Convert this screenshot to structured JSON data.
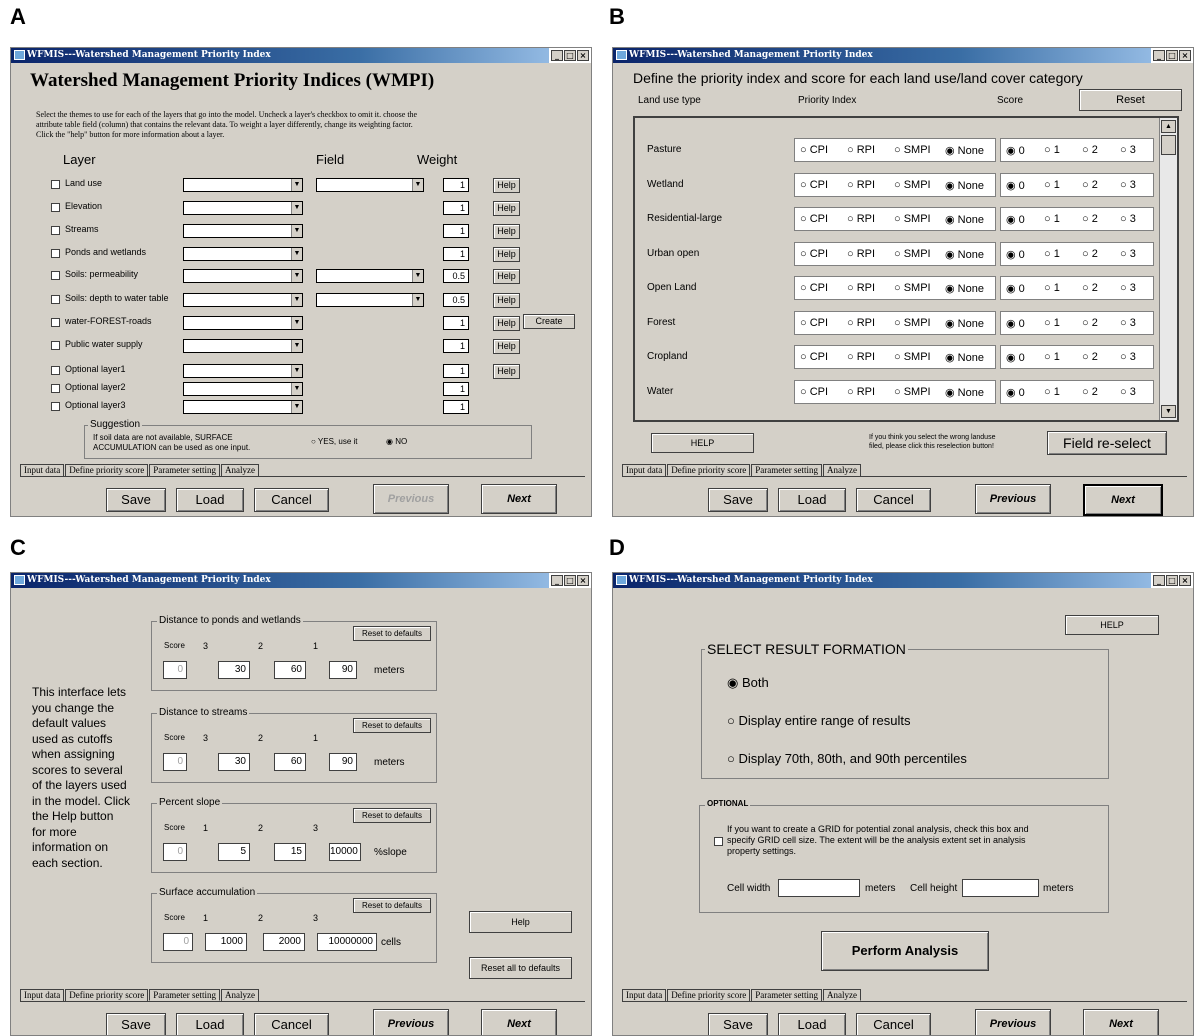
{
  "panels": {
    "A": {
      "label": "A",
      "title": "WFMIS---Watershed Management Priority Index",
      "heading": "Watershed Management Priority Indices (WMPI)",
      "instructions": [
        "Select the themes to use for each of the layers that go into the model. Uncheck a layer's checkbox to omit it. choose the",
        "attribute table field (column) that contains the relevant data. To weight a layer differently, change its weighting factor.",
        "Click the \"help\" button for more information about a layer."
      ],
      "col_layer": "Layer",
      "col_field": "Field",
      "col_weight": "Weight",
      "rows": [
        {
          "name": "Land use",
          "weight": "1",
          "help": "Help"
        },
        {
          "name": "Elevation",
          "weight": "1",
          "help": "Help"
        },
        {
          "name": "Streams",
          "weight": "1",
          "help": "Help"
        },
        {
          "name": "Ponds and wetlands",
          "weight": "1",
          "help": "Help"
        },
        {
          "name": "Soils: permeability",
          "weight": "0.5",
          "help": "Help"
        },
        {
          "name": "Soils: depth to water table",
          "weight": "0.5",
          "help": "Help"
        },
        {
          "name": "water-FOREST-roads",
          "weight": "1",
          "help": "Help"
        },
        {
          "name": "Public water supply",
          "weight": "1",
          "help": "Help"
        },
        {
          "name": "Optional layer1",
          "weight": "1",
          "help": "Help"
        },
        {
          "name": "Optional layer2",
          "weight": "1",
          "help": ""
        },
        {
          "name": "Optional layer3",
          "weight": "1",
          "help": ""
        }
      ],
      "create_label": "Create",
      "suggestion_title": "Suggestion",
      "suggestion_line1": "If soil data are not available, SURFACE",
      "suggestion_line2": "ACCUMULATION can be used as one input.",
      "yes_label": "YES, use it",
      "no_label": "NO"
    },
    "B": {
      "label": "B",
      "title": "WFMIS---Watershed Management Priority Index",
      "heading": "Define the priority index and score for each land use/land cover category",
      "col_type": "Land use type",
      "col_index": "Priority Index",
      "col_score": "Score",
      "reset_label": "Reset",
      "rows": [
        "Pasture",
        "Wetland",
        "Residential-large",
        "Urban open",
        "Open Land",
        "Forest",
        "Cropland",
        "Water"
      ],
      "index_options": [
        "CPI",
        "RPI",
        "SMPI",
        "None"
      ],
      "score_options": [
        "0",
        "1",
        "2",
        "3"
      ],
      "help_label": "HELP",
      "note_line1": "If you think you select the wrong landuse",
      "note_line2": "filed, please click this reselection button!",
      "reselect_label": "Field re-select"
    },
    "C": {
      "label": "C",
      "title": "WFMIS---Watershed Management Priority Index",
      "description": [
        "This interface lets",
        "you change the",
        "default values",
        "used as cutoffs",
        "when assigning",
        "scores to several",
        "of the layers used",
        "in the model. Click",
        "the Help button",
        "for more",
        "information on",
        "each section."
      ],
      "score_word": "Score",
      "reset_defaults": "Reset to defaults",
      "groups": [
        {
          "title": "Distance to ponds and wetlands",
          "scores": [
            "3",
            "2",
            "1"
          ],
          "values": [
            "0",
            "30",
            "60",
            "90"
          ],
          "unit": "meters"
        },
        {
          "title": "Distance to streams",
          "scores": [
            "3",
            "2",
            "1"
          ],
          "values": [
            "0",
            "30",
            "60",
            "90"
          ],
          "unit": "meters"
        },
        {
          "title": "Percent slope",
          "scores": [
            "1",
            "2",
            "3"
          ],
          "values": [
            "0",
            "5",
            "15",
            "10000"
          ],
          "unit": "%slope"
        },
        {
          "title": "Surface accumulation",
          "scores": [
            "1",
            "2",
            "3"
          ],
          "values": [
            "0",
            "1000",
            "2000",
            "10000000"
          ],
          "unit": "cells"
        }
      ],
      "help_label": "Help",
      "reset_all": "Reset all to defaults"
    },
    "D": {
      "label": "D",
      "title": "WFMIS---Watershed Management Priority Index",
      "help_label": "HELP",
      "select_title": "SELECT RESULT FORMATION",
      "options": [
        "Both",
        "Display entire range of results",
        "Display 70th, 80th, and 90th percentiles"
      ],
      "optional_title": "OPTIONAL",
      "optional_text": [
        "If you want to create a GRID for potential zonal analysis, check this box and",
        "specify GRID cell size. The extent will be the analysis extent set in analysis",
        "property settings."
      ],
      "cell_width": "Cell width",
      "cell_height": "Cell height",
      "meters": "meters",
      "perform": "Perform Analysis"
    }
  },
  "tabs": [
    "Input data",
    "Define priority score",
    "Parameter setting",
    "Analyze"
  ],
  "buttons": {
    "save": "Save",
    "load": "Load",
    "cancel": "Cancel",
    "previous": "Previous",
    "next": "Next"
  }
}
